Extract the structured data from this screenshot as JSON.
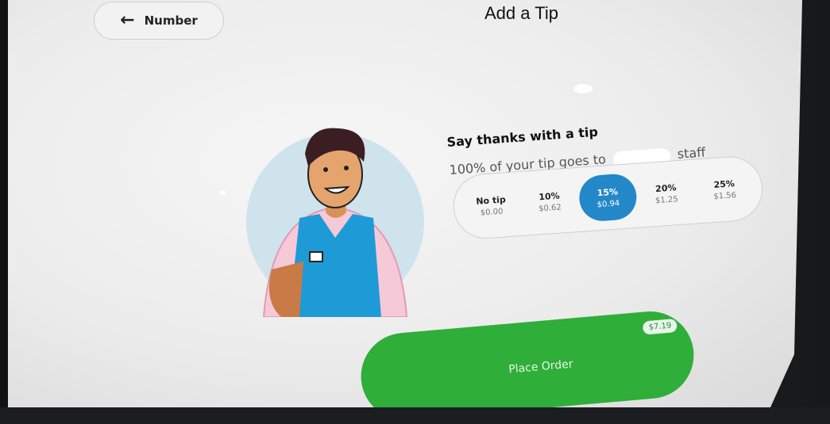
{
  "header": {
    "back_label": "Number",
    "title": "Add a Tip"
  },
  "tip_section": {
    "heading": "Say thanks with a tip",
    "subtext_before": "100% of your tip goes to",
    "subtext_after": "staff",
    "options": [
      {
        "label": "No tip",
        "amount": "$0.00"
      },
      {
        "label": "10%",
        "amount": "$0.62"
      },
      {
        "label": "15%",
        "amount": "$0.94"
      },
      {
        "label": "20%",
        "amount": "$1.25"
      },
      {
        "label": "25%",
        "amount": "$1.56"
      }
    ],
    "selected_label": "15%"
  },
  "order": {
    "button_label": "Place Order",
    "total": "$7.19"
  },
  "colors": {
    "accent_green": "#2fae3a",
    "selected_blue": "#2288c8",
    "apron_blue": "#1e9bd7"
  },
  "icons": {
    "back": "arrow-left-icon",
    "illustration": "barista-illustration"
  }
}
